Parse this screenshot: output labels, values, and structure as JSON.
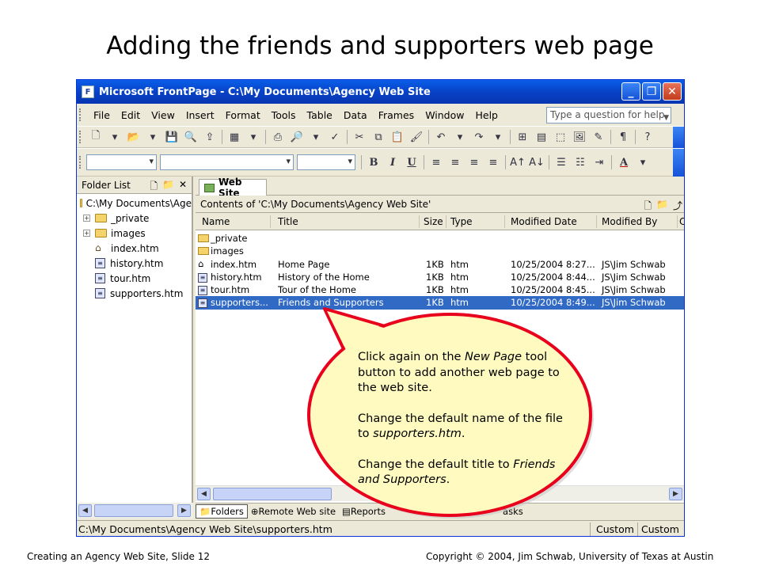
{
  "slide": {
    "title": "Adding the friends and supporters web page",
    "footer_left": "Creating an Agency Web Site, Slide 12",
    "footer_right": "Copyright © 2004, Jim Schwab, University of Texas at Austin"
  },
  "window": {
    "title": "Microsoft FrontPage - C:\\My Documents\\Agency Web Site",
    "menu": [
      "File",
      "Edit",
      "View",
      "Insert",
      "Format",
      "Tools",
      "Table",
      "Data",
      "Frames",
      "Window",
      "Help"
    ],
    "help_placeholder": "Type a question for help",
    "format_buttons": [
      "B",
      "I",
      "U",
      "A"
    ]
  },
  "folder_list": {
    "title": "Folder List",
    "root": "C:\\My Documents\\Age",
    "items": [
      {
        "name": "_private",
        "type": "folder"
      },
      {
        "name": "images",
        "type": "folder"
      },
      {
        "name": "index.htm",
        "type": "home"
      },
      {
        "name": "history.htm",
        "type": "page"
      },
      {
        "name": "tour.htm",
        "type": "page"
      },
      {
        "name": "supporters.htm",
        "type": "page"
      }
    ]
  },
  "main": {
    "tab": "Web Site",
    "contents": "Contents of 'C:\\My Documents\\Agency Web Site'",
    "columns": [
      "Name",
      "Title",
      "Size",
      "Type",
      "Modified Date",
      "Modified By",
      "C"
    ],
    "rows": [
      {
        "name": "_private",
        "title": "",
        "size": "",
        "type": "",
        "date": "",
        "by": "",
        "icon": "folder",
        "selected": false
      },
      {
        "name": "images",
        "title": "",
        "size": "",
        "type": "",
        "date": "",
        "by": "",
        "icon": "folder",
        "selected": false
      },
      {
        "name": "index.htm",
        "title": "Home Page",
        "size": "1KB",
        "type": "htm",
        "date": "10/25/2004 8:27...",
        "by": "JS\\Jim Schwab",
        "icon": "home",
        "selected": false
      },
      {
        "name": "history.htm",
        "title": "History of the Home",
        "size": "1KB",
        "type": "htm",
        "date": "10/25/2004 8:44...",
        "by": "JS\\Jim Schwab",
        "icon": "page",
        "selected": false
      },
      {
        "name": "tour.htm",
        "title": "Tour of the Home",
        "size": "1KB",
        "type": "htm",
        "date": "10/25/2004 8:45...",
        "by": "JS\\Jim Schwab",
        "icon": "page",
        "selected": false
      },
      {
        "name": "supporters...",
        "title": "Friends and Supporters",
        "size": "1KB",
        "type": "htm",
        "date": "10/25/2004 8:49...",
        "by": "JS\\Jim Schwab",
        "icon": "page",
        "selected": true
      }
    ]
  },
  "views": {
    "folders": "Folders",
    "remote": "Remote Web site",
    "reports": "Reports",
    "tasks": "asks"
  },
  "status": {
    "path": "C:\\My Documents\\Agency Web Site\\supporters.htm",
    "field1": "Custom",
    "field2": "Custom"
  },
  "callout": {
    "p1_pre": "Click again on the ",
    "p1_em": "New Page",
    "p1_post": " tool button to add another web page to the web site.",
    "p2_pre": "Change the default name of the file to ",
    "p2_em": "supporters.htm",
    "p2_post": ".",
    "p3_pre": "Change the default title to ",
    "p3_em": "Friends and Supporters",
    "p3_post": "."
  },
  "colors": {
    "titlebar": "#0842c8",
    "selection": "#316ac5",
    "callout_fill": "#fffbc0",
    "callout_border": "#e8001c"
  }
}
